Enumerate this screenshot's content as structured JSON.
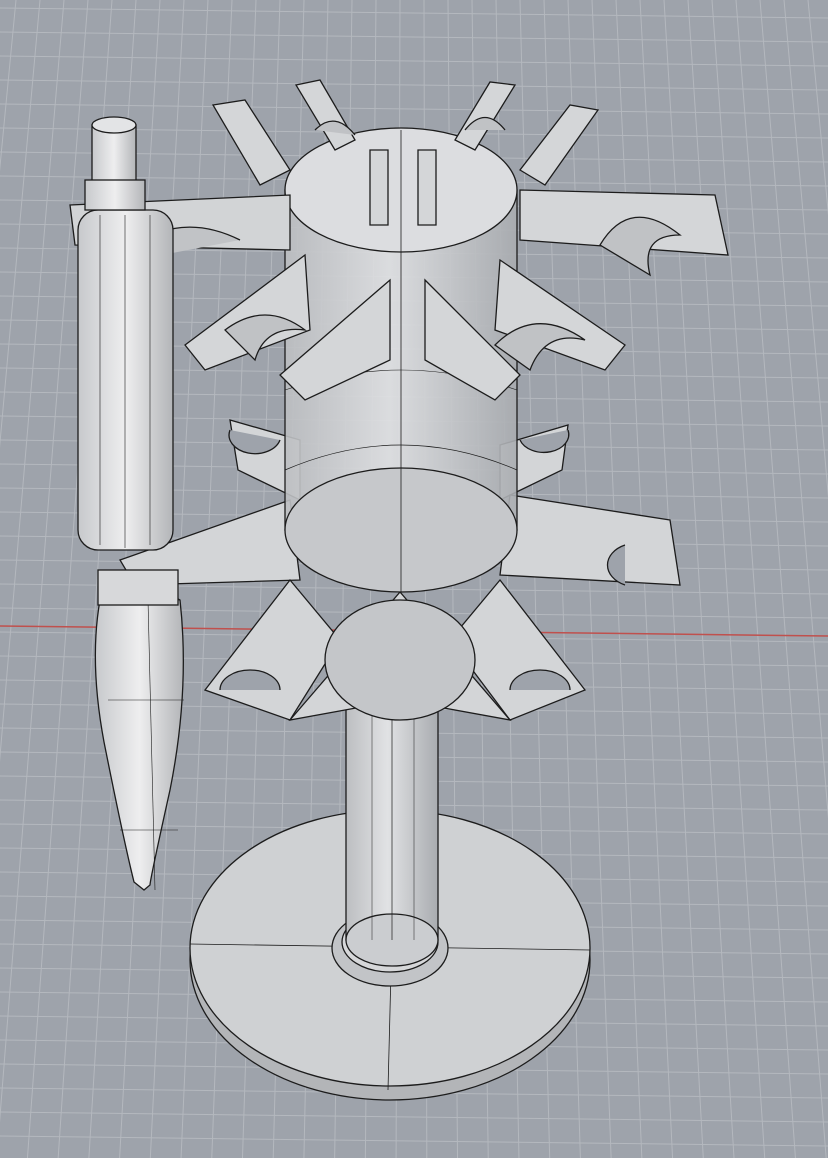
{
  "viewport": {
    "background": "#9ea3ab",
    "grid_color": "#b4b8be",
    "x_axis_color": "#c0504d",
    "y_axis_color": "#5e8f5a"
  },
  "model": {
    "surface_color": "#d9dadc",
    "surface_dark": "#b9bbbe",
    "edge_color": "#1c1c1c",
    "display_mode": "ghosted-shaded-with-isocurves"
  }
}
